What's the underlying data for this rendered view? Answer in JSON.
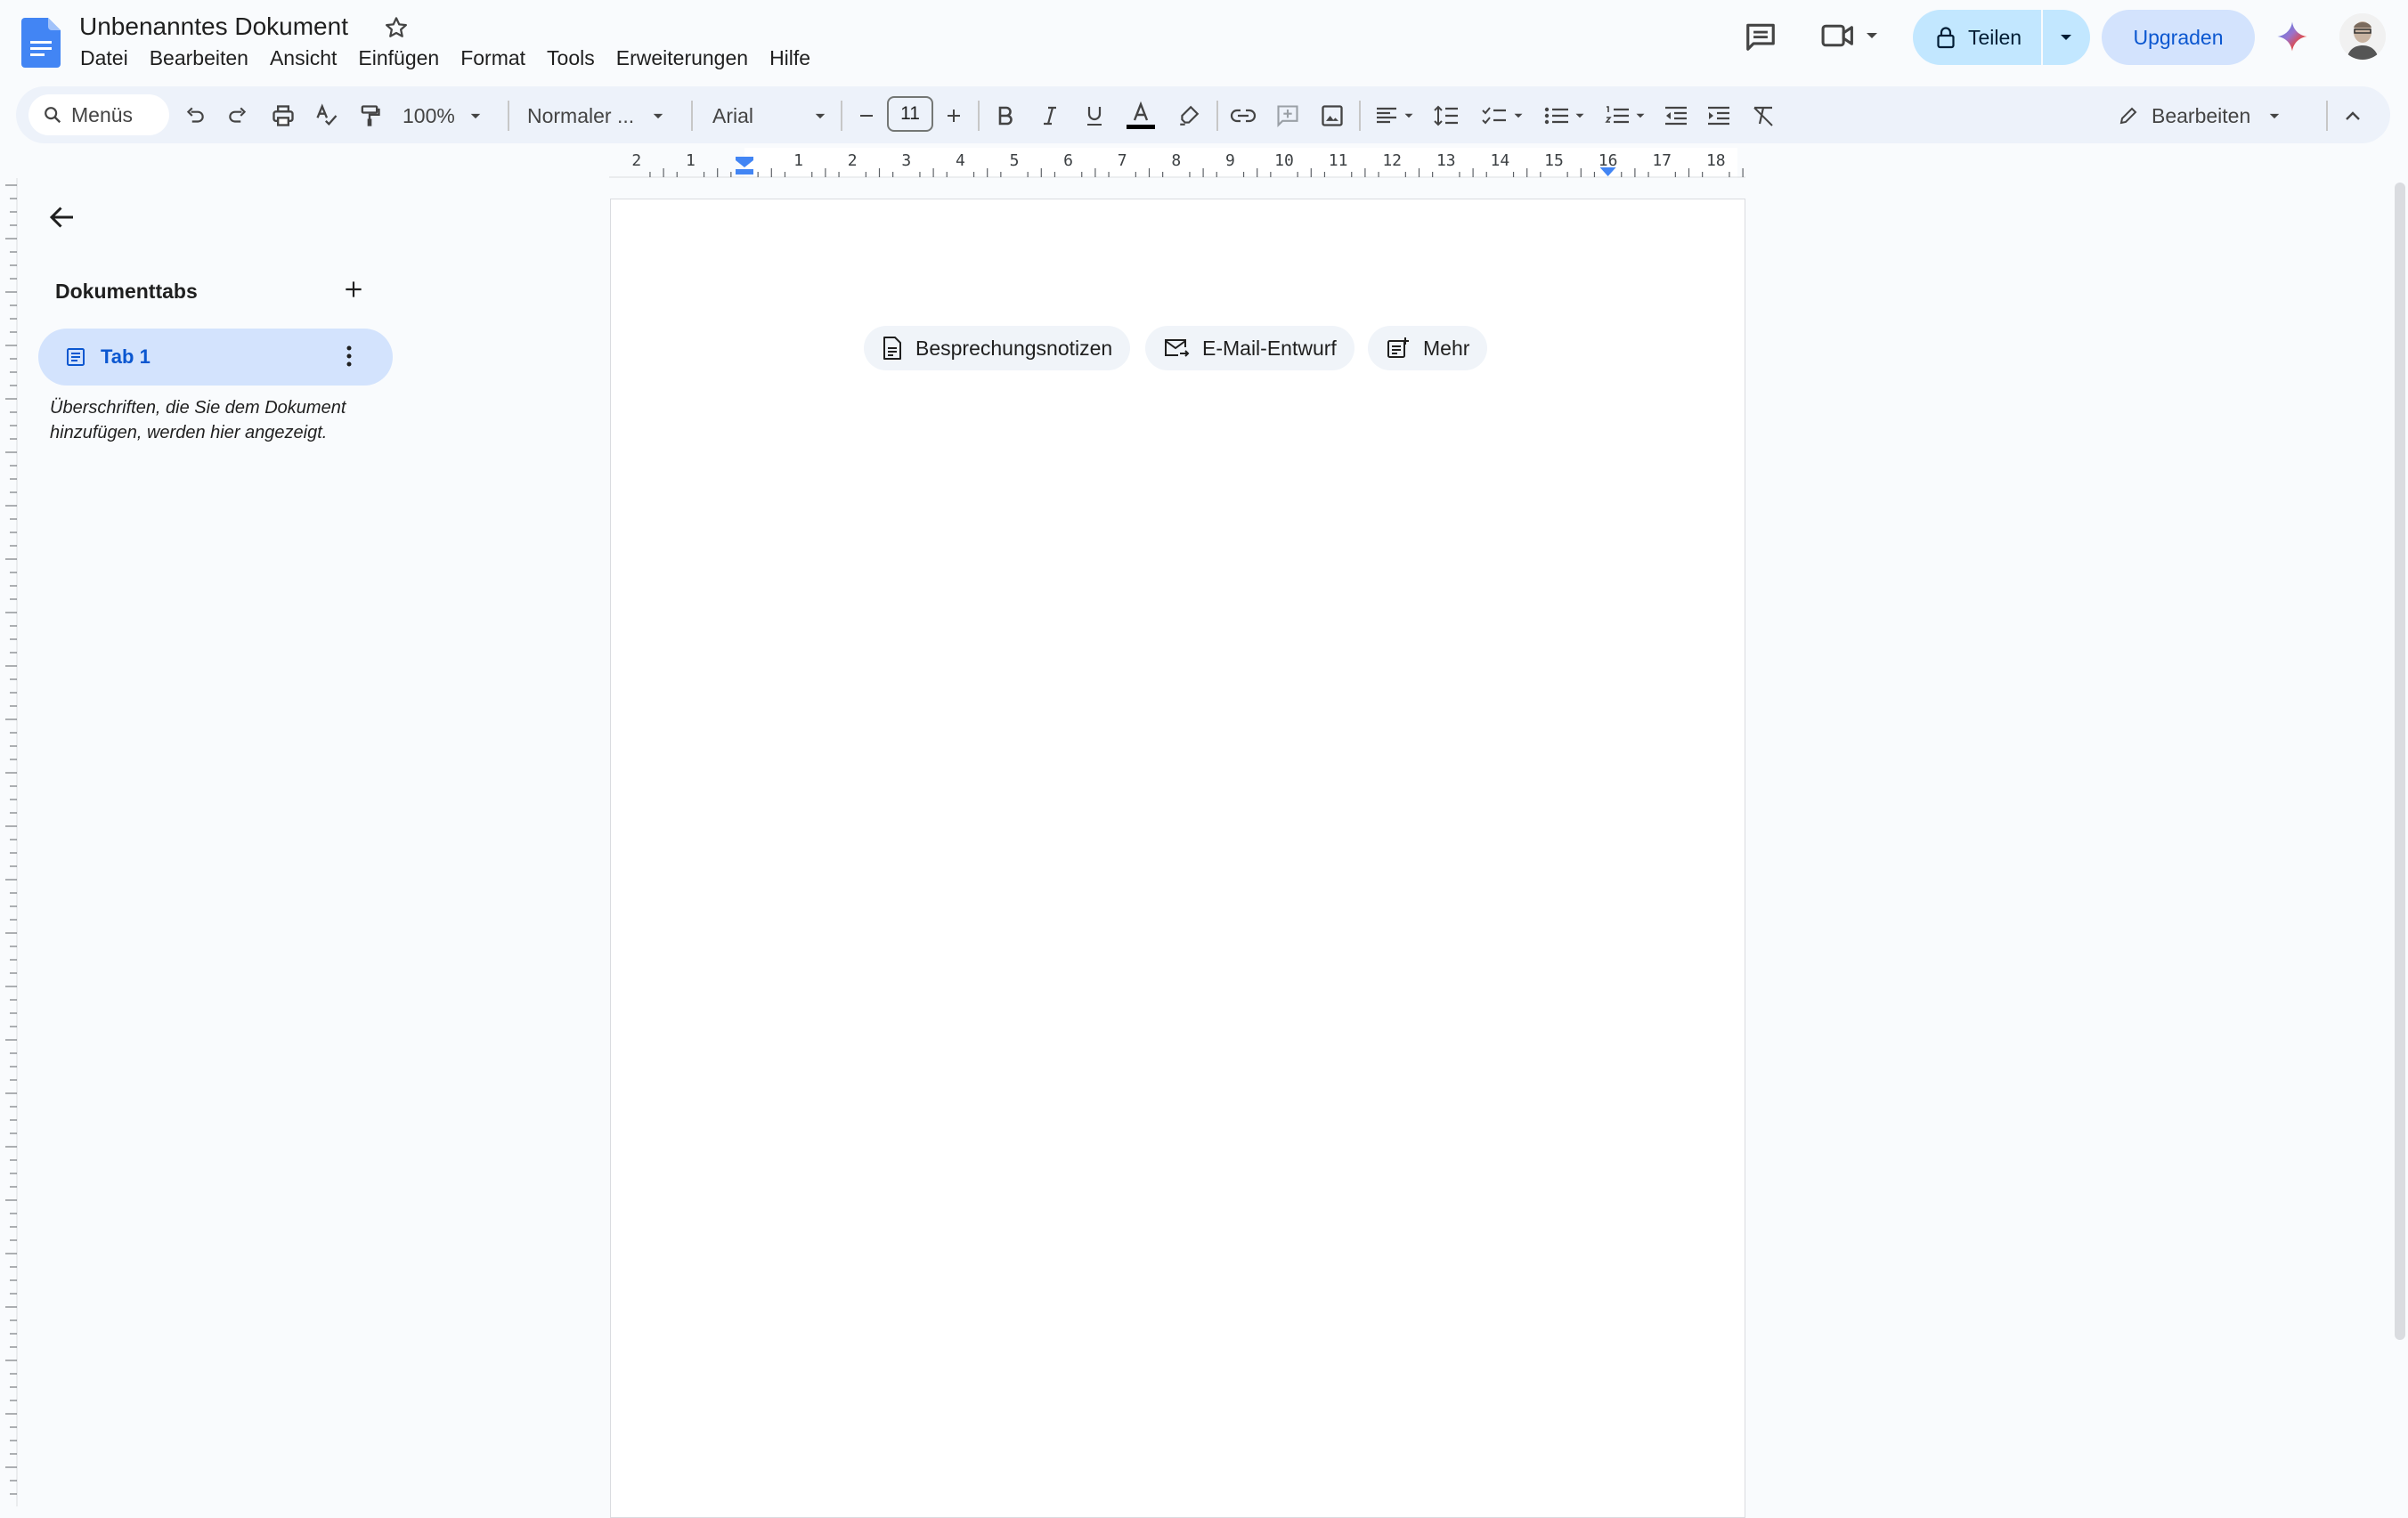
{
  "header": {
    "title": "Unbenanntes Dokument",
    "icons": {
      "app": "docs-logo-icon",
      "star": "star-icon",
      "comments": "comment-icon",
      "meet": "video-camera-icon",
      "gemini": "gemini-sparkle-icon"
    },
    "menus": [
      "Datei",
      "Bearbeiten",
      "Ansicht",
      "Einfügen",
      "Format",
      "Tools",
      "Erweiterungen",
      "Hilfe"
    ],
    "share_label": "Teilen",
    "upgrade_label": "Upgraden"
  },
  "toolbar": {
    "search_label": "Menüs",
    "zoom": "100%",
    "style": "Normaler ...",
    "font": "Arial",
    "font_size": "11",
    "mode_label": "Bearbeiten"
  },
  "ruler": {
    "labels": [
      "2",
      "1",
      "1",
      "2",
      "3",
      "4",
      "5",
      "6",
      "7",
      "8",
      "9",
      "10",
      "11",
      "12",
      "13",
      "14",
      "15",
      "16",
      "17",
      "18"
    ]
  },
  "sidebar": {
    "heading": "Dokumenttabs",
    "tabs": [
      {
        "label": "Tab 1"
      }
    ],
    "hint": "Überschriften, die Sie dem Dokument hinzufügen, werden hier angezeigt."
  },
  "document": {
    "chips": [
      {
        "label": "Besprechungsnotizen",
        "icon": "document-icon"
      },
      {
        "label": "E-Mail-Entwurf",
        "icon": "email-draft-icon"
      },
      {
        "label": "Mehr",
        "icon": "more-templates-icon"
      }
    ]
  },
  "colors": {
    "accent": "#0b57d0",
    "share_bg": "#c2e7ff",
    "upgrade_bg": "#d3e3fd",
    "toolbar_bg": "#edf2fa",
    "app_bg": "#f9fbfd"
  }
}
